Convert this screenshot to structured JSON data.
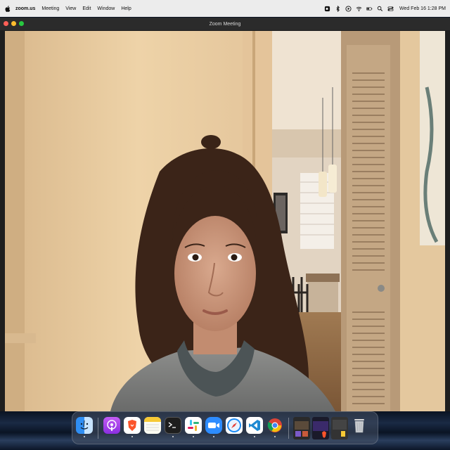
{
  "menubar": {
    "app_name": "zoom.us",
    "items": [
      "Meeting",
      "View",
      "Edit",
      "Window",
      "Help"
    ],
    "clock": "Wed Feb 16  1:28 PM",
    "status_icons": [
      "zoom-status-icon",
      "bluetooth-icon",
      "play-icon",
      "wifi-icon",
      "battery-icon",
      "search-icon",
      "control-center-icon"
    ]
  },
  "window": {
    "title": "Zoom Meeting",
    "traffic_lights": {
      "close": "#ff5f57",
      "minimize": "#febc2e",
      "zoom": "#28c840"
    }
  },
  "dock": {
    "apps": [
      {
        "name": "finder",
        "color": "#3b9cf4"
      },
      {
        "name": "podcasts",
        "color": "#9b4ee6"
      },
      {
        "name": "brave",
        "color": "#fb542b"
      },
      {
        "name": "notes",
        "color": "#f6f6f0"
      },
      {
        "name": "terminal",
        "color": "#1c1c1c"
      },
      {
        "name": "slack",
        "color": "#ffffff"
      },
      {
        "name": "zoom",
        "color": "#2d8cff"
      },
      {
        "name": "safari",
        "color": "#e8f2ff"
      },
      {
        "name": "vscode",
        "color": "#ffffff"
      },
      {
        "name": "chrome",
        "color": "#ffffff"
      }
    ],
    "minimized_windows": 3,
    "trash": "trash-icon"
  }
}
